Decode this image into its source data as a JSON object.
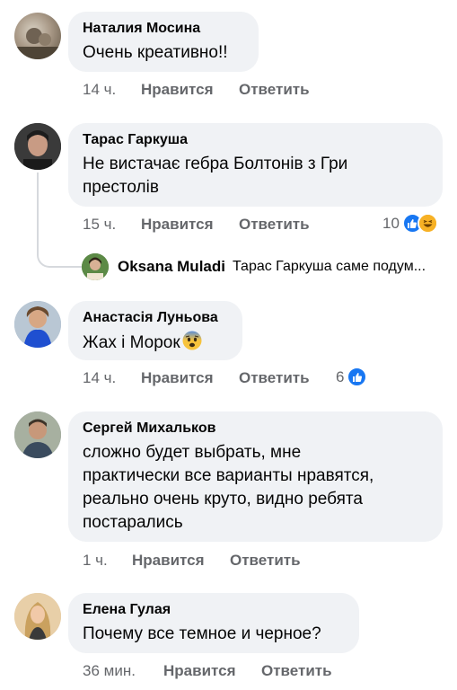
{
  "comments": [
    {
      "author": "Наталия Мосина",
      "text": "Очень креативно!!",
      "time": "14 ч.",
      "like_label": "Нравится",
      "reply_label": "Ответить"
    },
    {
      "author": "Тарас Гаркуша",
      "text_line1": "Не вистачає гебра Болтонів з Гри",
      "text_line2": "престолів",
      "time": "15 ч.",
      "like_label": "Нравится",
      "reply_label": "Ответить",
      "reaction_count": "10",
      "reply": {
        "author": "Oksana Muladi",
        "text": "Тарас Гаркуша саме подум..."
      }
    },
    {
      "author": "Анастасія Луньова",
      "text": "Жах і Морок",
      "time": "14 ч.",
      "like_label": "Нравится",
      "reply_label": "Ответить",
      "reaction_count": "6"
    },
    {
      "author": "Сергей Михальков",
      "text_line1": "сложно будет выбрать, мне",
      "text_line2": "практически все варианты нравятся,",
      "text_line3": "реально очень круто, видно ребята",
      "text_line4": "постарались",
      "time": "1 ч.",
      "like_label": "Нравится",
      "reply_label": "Ответить"
    },
    {
      "author": "Елена Гулая",
      "text": "Почему все темное и черное?",
      "time": "36 мин.",
      "like_label": "Нравится",
      "reply_label": "Ответить"
    }
  ],
  "colors": {
    "bubble": "#f0f2f5",
    "meta_text": "#65676b",
    "like_blue": "#1877f2",
    "haha_yellow": "#f7b125"
  },
  "icons": [
    "like-icon",
    "haha-icon",
    "fearful-emoji-icon"
  ]
}
